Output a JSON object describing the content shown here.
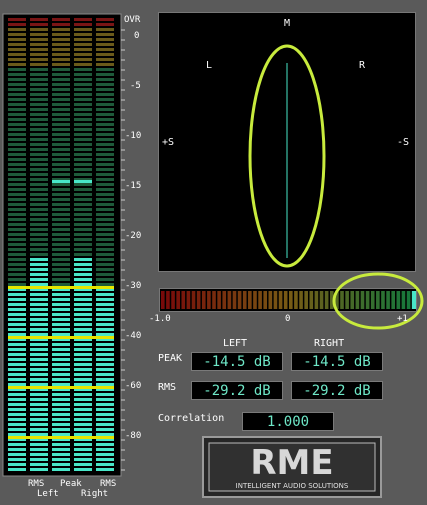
{
  "level_meter": {
    "scale": [
      "OVR",
      "0",
      "-5",
      "-10",
      "-15",
      "-20",
      "-30",
      "-40",
      "-60",
      "-80"
    ],
    "bottom_labels": {
      "rms_left": "RMS",
      "peak": "Peak",
      "rms_right": "RMS",
      "left": "Left",
      "right": "Right"
    },
    "rms_level_db": -29.2,
    "peak_level_db": -14.5
  },
  "goniometer": {
    "top": "M",
    "left": "L",
    "right": "R",
    "plus_s": "+S",
    "minus_s": "-S"
  },
  "correlation_meter": {
    "scale_left": "-1.0",
    "scale_mid": "0",
    "scale_right": "+1",
    "value": 1.0
  },
  "readouts": {
    "col_left": "LEFT",
    "col_right": "RIGHT",
    "peak_label": "PEAK",
    "rms_label": "RMS",
    "peak_left": "-14.5 dB",
    "peak_right": "-14.5 dB",
    "rms_left": "-29.2 dB",
    "rms_right": "-29.2 dB",
    "correlation_label": "Correlation",
    "correlation_value": "1.000"
  },
  "logo": {
    "brand": "RME",
    "tagline": "INTELLIGENT AUDIO SOLUTIONS"
  },
  "colors": {
    "segment_on": "#49e6c8",
    "segment_off": "#1e5a3a",
    "peak_hold": "#49e6c8",
    "marker_yellow": "#e6e600",
    "highlight_circle": "#c8eb3d",
    "readout_text": "#6ee7c7"
  }
}
